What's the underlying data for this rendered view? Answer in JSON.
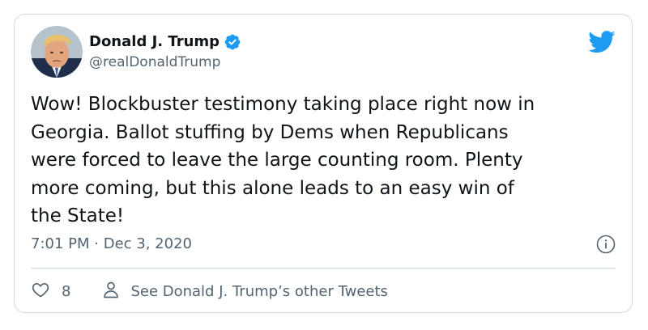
{
  "author": {
    "display_name": "Donald J. Trump",
    "handle": "@realDonaldTrump",
    "verified": true
  },
  "tweet": {
    "text": "Wow! Blockbuster testimony taking place right now in\nGeorgia. Ballot stuffing by Dems when Republicans\nwere forced to leave the large counting room. Plenty\nmore coming, but this alone leads to an easy win of\nthe State!",
    "time": "7:01 PM",
    "separator": "·",
    "date": "Dec 3, 2020"
  },
  "actions": {
    "like_count": "8",
    "other_tweets_label": "See Donald J. Trump’s other Tweets"
  },
  "icons": {
    "brand": "twitter-bird-icon",
    "verified": "verified-badge-icon",
    "info": "info-icon",
    "like": "heart-icon",
    "profile": "person-icon"
  },
  "colors": {
    "brand_blue": "#1d9bf0",
    "text_primary": "#0f1419",
    "text_secondary": "#536471",
    "border": "#cfd9de"
  }
}
